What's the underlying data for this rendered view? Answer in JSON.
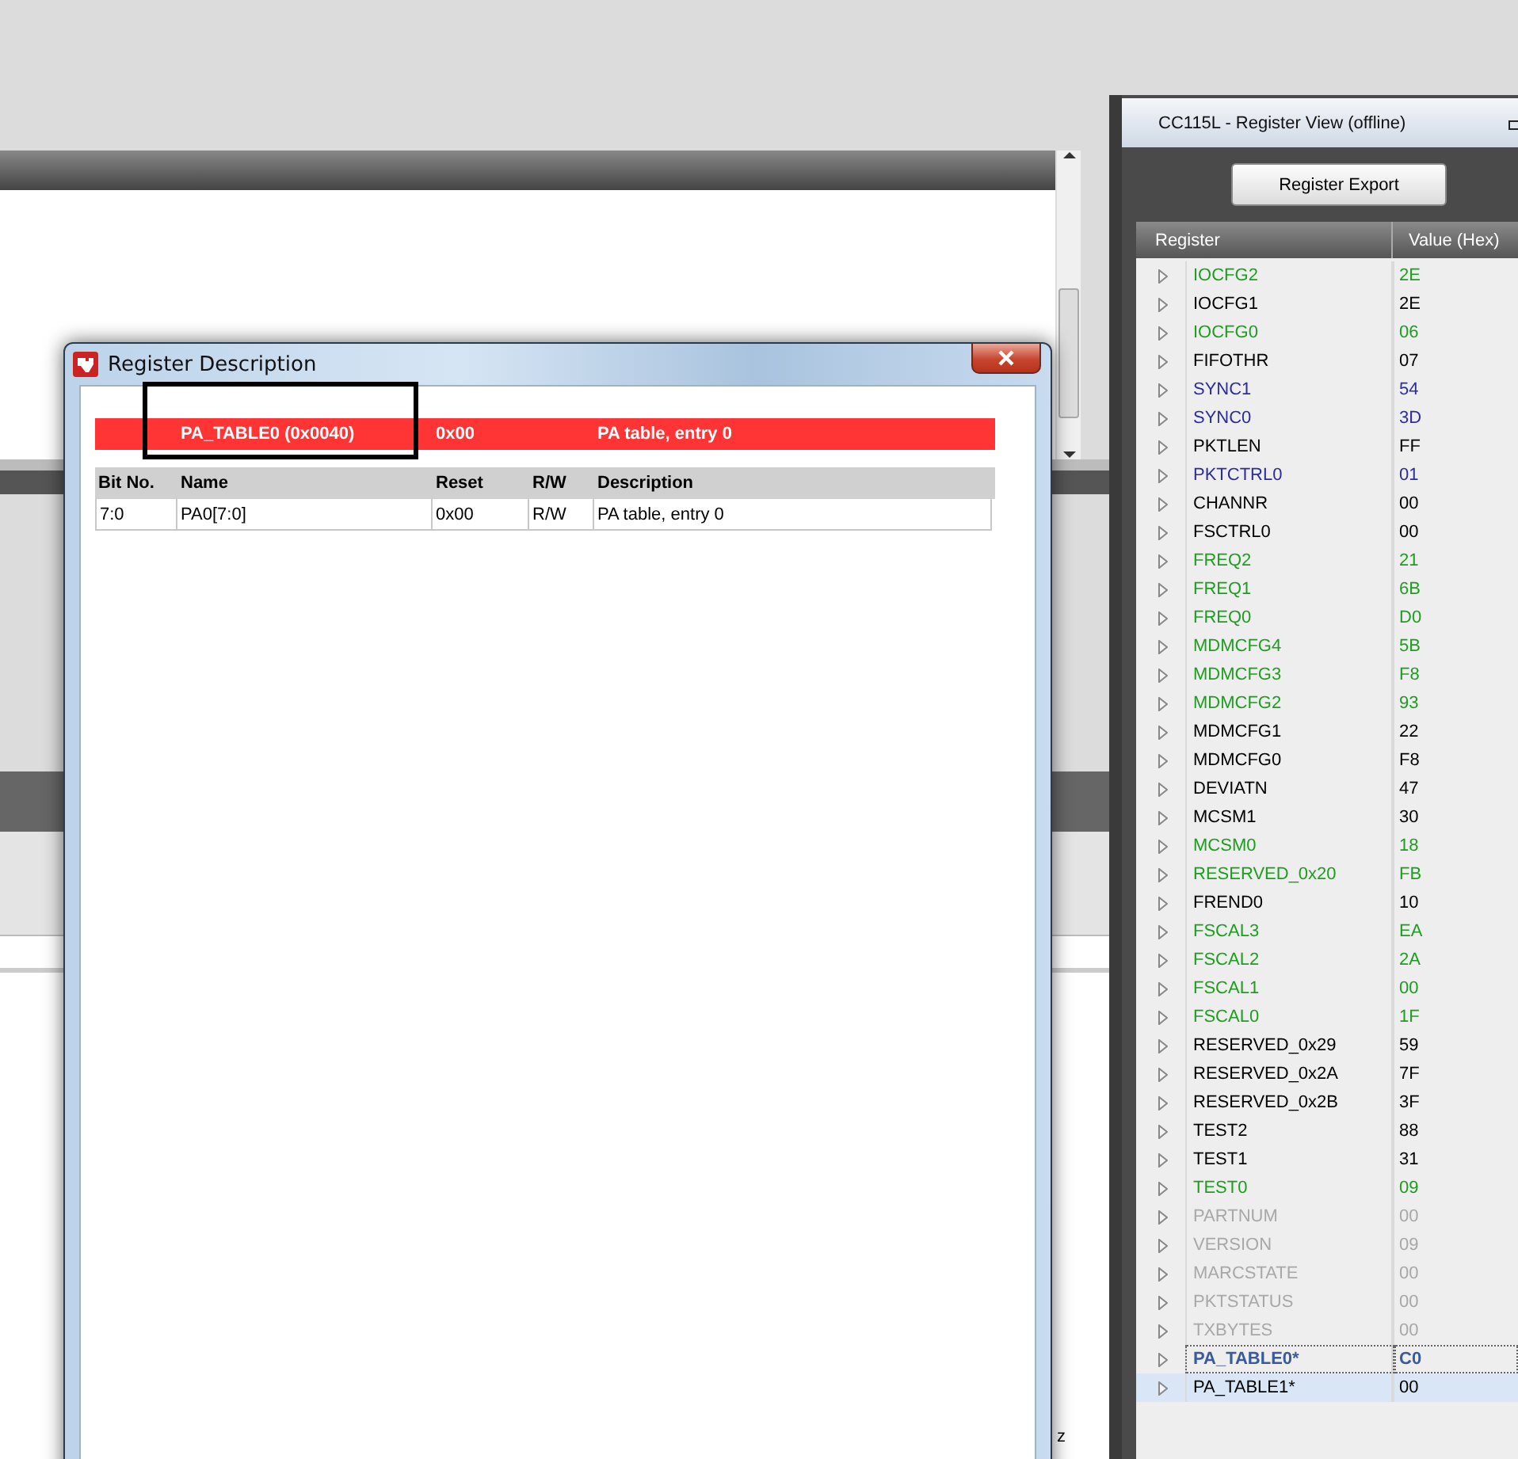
{
  "background": {
    "status_fragment": "z"
  },
  "dialog": {
    "title": "Register Description",
    "register": {
      "name": "PA_TABLE0 (0x0040)",
      "reset": "0x00",
      "description": "PA table, entry 0"
    },
    "columns": [
      "Bit No.",
      "Name",
      "Reset",
      "R/W",
      "Description"
    ],
    "fields": [
      {
        "bits": "7:0",
        "name": "PA0[7:0]",
        "reset": "0x00",
        "rw": "R/W",
        "description": "PA table, entry 0"
      }
    ]
  },
  "register_view": {
    "title": "CC115L - Register View (offline)",
    "export_button": "Register Export",
    "columns": [
      "Register",
      "Value (Hex)"
    ],
    "registers": [
      {
        "name": "IOCFG2",
        "value": "2E",
        "color": "#1e9e1e",
        "selected": false,
        "focused": false
      },
      {
        "name": "IOCFG1",
        "value": "2E",
        "color": "#000000",
        "selected": false,
        "focused": false
      },
      {
        "name": "IOCFG0",
        "value": "06",
        "color": "#1e9e1e",
        "selected": false,
        "focused": false
      },
      {
        "name": "FIFOTHR",
        "value": "07",
        "color": "#000000",
        "selected": false,
        "focused": false
      },
      {
        "name": "SYNC1",
        "value": "54",
        "color": "#2c2ca0",
        "selected": false,
        "focused": false
      },
      {
        "name": "SYNC0",
        "value": "3D",
        "color": "#2c2ca0",
        "selected": false,
        "focused": false
      },
      {
        "name": "PKTLEN",
        "value": "FF",
        "color": "#000000",
        "selected": false,
        "focused": false
      },
      {
        "name": "PKTCTRL0",
        "value": "01",
        "color": "#2c2ca0",
        "selected": false,
        "focused": false
      },
      {
        "name": "CHANNR",
        "value": "00",
        "color": "#000000",
        "selected": false,
        "focused": false
      },
      {
        "name": "FSCTRL0",
        "value": "00",
        "color": "#000000",
        "selected": false,
        "focused": false
      },
      {
        "name": "FREQ2",
        "value": "21",
        "color": "#1e9e1e",
        "selected": false,
        "focused": false
      },
      {
        "name": "FREQ1",
        "value": "6B",
        "color": "#1e9e1e",
        "selected": false,
        "focused": false
      },
      {
        "name": "FREQ0",
        "value": "D0",
        "color": "#1e9e1e",
        "selected": false,
        "focused": false
      },
      {
        "name": "MDMCFG4",
        "value": "5B",
        "color": "#1e9e1e",
        "selected": false,
        "focused": false
      },
      {
        "name": "MDMCFG3",
        "value": "F8",
        "color": "#1e9e1e",
        "selected": false,
        "focused": false
      },
      {
        "name": "MDMCFG2",
        "value": "93",
        "color": "#1e9e1e",
        "selected": false,
        "focused": false
      },
      {
        "name": "MDMCFG1",
        "value": "22",
        "color": "#000000",
        "selected": false,
        "focused": false
      },
      {
        "name": "MDMCFG0",
        "value": "F8",
        "color": "#000000",
        "selected": false,
        "focused": false
      },
      {
        "name": "DEVIATN",
        "value": "47",
        "color": "#000000",
        "selected": false,
        "focused": false
      },
      {
        "name": "MCSM1",
        "value": "30",
        "color": "#000000",
        "selected": false,
        "focused": false
      },
      {
        "name": "MCSM0",
        "value": "18",
        "color": "#1e9e1e",
        "selected": false,
        "focused": false
      },
      {
        "name": "RESERVED_0x20",
        "value": "FB",
        "color": "#1e9e1e",
        "selected": false,
        "focused": false
      },
      {
        "name": "FREND0",
        "value": "10",
        "color": "#000000",
        "selected": false,
        "focused": false
      },
      {
        "name": "FSCAL3",
        "value": "EA",
        "color": "#1e9e1e",
        "selected": false,
        "focused": false
      },
      {
        "name": "FSCAL2",
        "value": "2A",
        "color": "#1e9e1e",
        "selected": false,
        "focused": false
      },
      {
        "name": "FSCAL1",
        "value": "00",
        "color": "#1e9e1e",
        "selected": false,
        "focused": false
      },
      {
        "name": "FSCAL0",
        "value": "1F",
        "color": "#1e9e1e",
        "selected": false,
        "focused": false
      },
      {
        "name": "RESERVED_0x29",
        "value": "59",
        "color": "#000000",
        "selected": false,
        "focused": false
      },
      {
        "name": "RESERVED_0x2A",
        "value": "7F",
        "color": "#000000",
        "selected": false,
        "focused": false
      },
      {
        "name": "RESERVED_0x2B",
        "value": "3F",
        "color": "#000000",
        "selected": false,
        "focused": false
      },
      {
        "name": "TEST2",
        "value": "88",
        "color": "#000000",
        "selected": false,
        "focused": false
      },
      {
        "name": "TEST1",
        "value": "31",
        "color": "#000000",
        "selected": false,
        "focused": false
      },
      {
        "name": "TEST0",
        "value": "09",
        "color": "#1e9e1e",
        "selected": false,
        "focused": false
      },
      {
        "name": "PARTNUM",
        "value": "00",
        "color": "#a8a8a8",
        "selected": false,
        "focused": false
      },
      {
        "name": "VERSION",
        "value": "09",
        "color": "#a8a8a8",
        "selected": false,
        "focused": false
      },
      {
        "name": "MARCSTATE",
        "value": "00",
        "color": "#a8a8a8",
        "selected": false,
        "focused": false
      },
      {
        "name": "PKTSTATUS",
        "value": "00",
        "color": "#a8a8a8",
        "selected": false,
        "focused": false
      },
      {
        "name": "TXBYTES",
        "value": "00",
        "color": "#a8a8a8",
        "selected": false,
        "focused": false
      },
      {
        "name": "PA_TABLE0*",
        "value": "C0",
        "color": "#3a5a9a",
        "selected": false,
        "focused": true
      },
      {
        "name": "PA_TABLE1*",
        "value": "00",
        "color": "#000000",
        "selected": true,
        "focused": false
      }
    ]
  }
}
